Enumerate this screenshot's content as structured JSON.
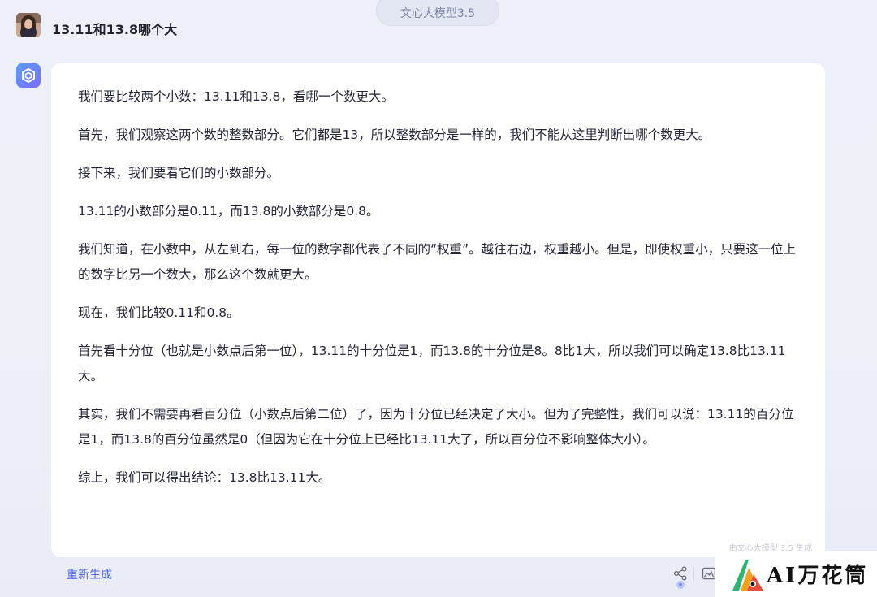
{
  "header": {
    "model_pill": "文心大模型3.5"
  },
  "user": {
    "question": "13.11和13.8哪个大"
  },
  "answer": {
    "paragraphs": [
      "我们要比较两个小数：13.11和13.8，看哪一个数更大。",
      "首先，我们观察这两个数的整数部分。它们都是13，所以整数部分是一样的，我们不能从这里判断出哪个数更大。",
      "接下来，我们要看它们的小数部分。",
      "13.11的小数部分是0.11，而13.8的小数部分是0.8。",
      "我们知道，在小数中，从左到右，每一位的数字都代表了不同的“权重”。越往右边，权重越小。但是，即使权重小，只要这一位上的数字比另一个数大，那么这个数就更大。",
      "现在，我们比较0.11和0.8。",
      "首先看十分位（也就是小数点后第一位），13.11的十分位是1，而13.8的十分位是8。8比1大，所以我们可以确定13.8比13.11大。",
      "其实，我们不需要再看百分位（小数点后第二位）了，因为十分位已经决定了大小。但为了完整性，我们可以说：13.11的百分位是1，而13.8的百分位虽然是0（但因为它在十分位上已经比13.11大了，所以百分位不影响整体大小）。",
      "综上，我们可以得出结论：13.8比13.11大。"
    ],
    "generated_by": "由文心大模型 3.5 生成"
  },
  "actions": {
    "regenerate": "重新生成"
  },
  "watermark": {
    "text": "AI万花筒"
  },
  "colors": {
    "accent": "#4f67e8",
    "background": "#edf0f8",
    "card": "#ffffff"
  },
  "icons": {
    "share": "share-icon",
    "image": "image-icon",
    "bot": "wenxin-logo-icon"
  }
}
